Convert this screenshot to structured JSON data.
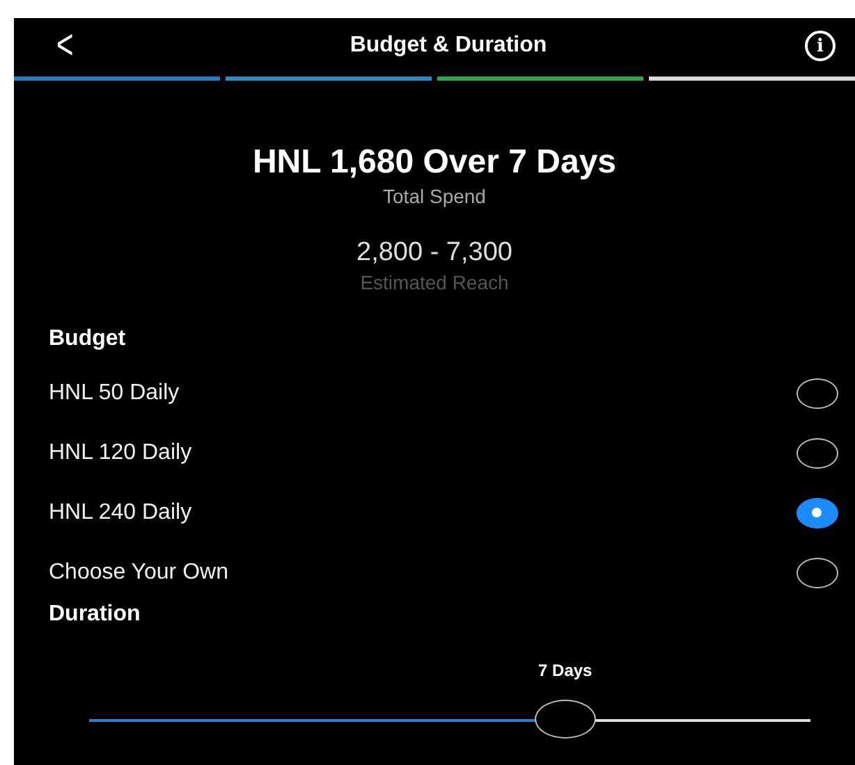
{
  "header": {
    "back": "<",
    "title": "Budget & Duration",
    "info": "i"
  },
  "steps": [
    {
      "color": "#1f7fc4"
    },
    {
      "color": "#1f8fc4"
    },
    {
      "color": "#2aa84a"
    },
    {
      "color": "#d8d8d8"
    }
  ],
  "summary": {
    "total": "HNL 1,680 Over 7 Days",
    "total_label": "Total Spend",
    "reach": "2,800 - 7,300",
    "reach_label": "Estimated Reach"
  },
  "budget": {
    "heading": "Budget",
    "options": [
      {
        "label": "HNL 50 Daily",
        "selected": false
      },
      {
        "label": "HNL 120 Daily",
        "selected": false
      },
      {
        "label": "HNL 240 Daily",
        "selected": true
      },
      {
        "label": "Choose Your Own",
        "selected": false
      }
    ]
  },
  "duration": {
    "heading": "Duration",
    "value": "7 Days",
    "level": 0.66
  }
}
